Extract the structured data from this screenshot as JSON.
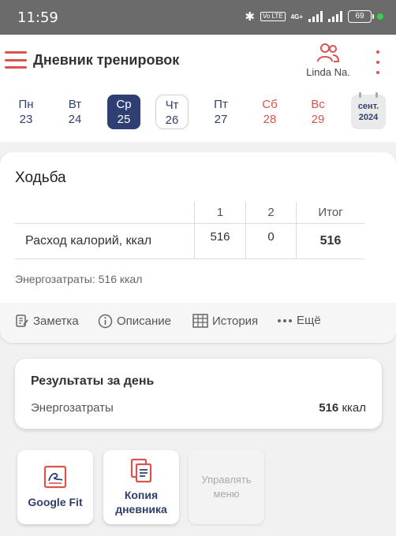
{
  "status_bar": {
    "time": "11:59",
    "network": "4G+",
    "volte": "Vo LTE",
    "battery": "69"
  },
  "header": {
    "title": "Дневник тренировок",
    "user_name": "Linda Na."
  },
  "week": {
    "days": [
      {
        "abbr": "Пн",
        "num": "23"
      },
      {
        "abbr": "Вт",
        "num": "24"
      },
      {
        "abbr": "Ср",
        "num": "25"
      },
      {
        "abbr": "Чт",
        "num": "26"
      },
      {
        "abbr": "Пт",
        "num": "27"
      },
      {
        "abbr": "Сб",
        "num": "28"
      },
      {
        "abbr": "Вс",
        "num": "29"
      }
    ],
    "selected_index": 2,
    "month": "сент.",
    "year": "2024"
  },
  "exercise": {
    "title": "Ходьба",
    "columns": [
      "1",
      "2",
      "Итог"
    ],
    "rows": [
      {
        "label": "Расход калорий, ккал",
        "values": [
          "516",
          "0"
        ],
        "total": "516"
      }
    ],
    "energy_line": "Энергозатраты: 516 ккал",
    "actions": {
      "note": "Заметка",
      "description": "Описание",
      "history": "История",
      "more": "Ещё"
    }
  },
  "results": {
    "title": "Результаты за день",
    "label": "Энергозатраты",
    "value": "516",
    "unit": "ккал"
  },
  "tiles": {
    "google_fit": "Google Fit",
    "copy_line1": "Копия",
    "copy_line2": "дневника",
    "manage_line1": "Управлять",
    "manage_line2": "меню"
  },
  "colors": {
    "accent": "#d9534f",
    "navy": "#2f3f73"
  }
}
